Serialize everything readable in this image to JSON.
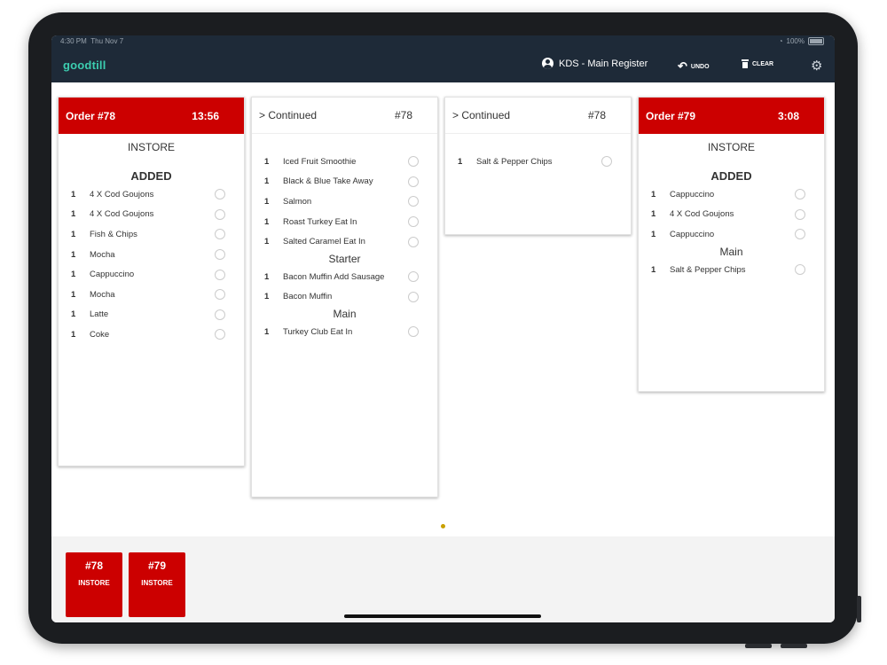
{
  "status": {
    "time": "4:30 PM",
    "date": "Thu Nov 7",
    "battery": "100%"
  },
  "app": {
    "logo": "goodtill",
    "register": "KDS - Main Register",
    "undo_label": "UNDO",
    "clear_label": "CLEAR"
  },
  "colors": {
    "accent_red": "#cc0000",
    "header_navy": "#1e2a38",
    "logo_teal": "#3ccdb0"
  },
  "tickets": [
    {
      "left": "Order #78",
      "right": "13:56",
      "type": "INSTORE",
      "section": "ADDED",
      "items": [
        {
          "qty": "1",
          "name": "4 X Cod Goujons"
        },
        {
          "qty": "1",
          "name": "4 X Cod Goujons"
        },
        {
          "qty": "1",
          "name": "Fish & Chips"
        },
        {
          "qty": "1",
          "name": "Mocha"
        },
        {
          "qty": "1",
          "name": "Cappuccino"
        },
        {
          "qty": "1",
          "name": "Mocha"
        },
        {
          "qty": "1",
          "name": "Latte"
        },
        {
          "qty": "1",
          "name": "Coke"
        }
      ]
    },
    {
      "left": "> Continued",
      "right": "#78",
      "items": [
        {
          "qty": "1",
          "name": "Iced Fruit Smoothie"
        },
        {
          "qty": "1",
          "name": "Black & Blue Take Away"
        },
        {
          "qty": "1",
          "name": "Salmon"
        },
        {
          "qty": "1",
          "name": "Roast Turkey Eat In"
        },
        {
          "qty": "1",
          "name": "Salted Caramel Eat In"
        }
      ],
      "starter_label": "Starter",
      "starter_items": [
        {
          "qty": "1",
          "name": "Bacon Muffin Add Sausage"
        },
        {
          "qty": "1",
          "name": "Bacon Muffin"
        }
      ],
      "main_label": "Main",
      "main_items": [
        {
          "qty": "1",
          "name": "Turkey Club Eat In"
        }
      ]
    },
    {
      "left": "> Continued",
      "right": "#78",
      "items": [
        {
          "qty": "1",
          "name": "Salt & Pepper Chips"
        }
      ]
    },
    {
      "left": "Order #79",
      "right": "3:08",
      "type": "INSTORE",
      "section": "ADDED",
      "items": [
        {
          "qty": "1",
          "name": "Cappuccino"
        },
        {
          "qty": "1",
          "name": "4 X Cod Goujons"
        },
        {
          "qty": "1",
          "name": "Cappuccino"
        }
      ],
      "main_label": "Main",
      "main_items": [
        {
          "qty": "1",
          "name": "Salt & Pepper Chips"
        }
      ]
    }
  ],
  "order_tiles": [
    {
      "number": "#78",
      "type": "INSTORE"
    },
    {
      "number": "#79",
      "type": "INSTORE"
    }
  ]
}
